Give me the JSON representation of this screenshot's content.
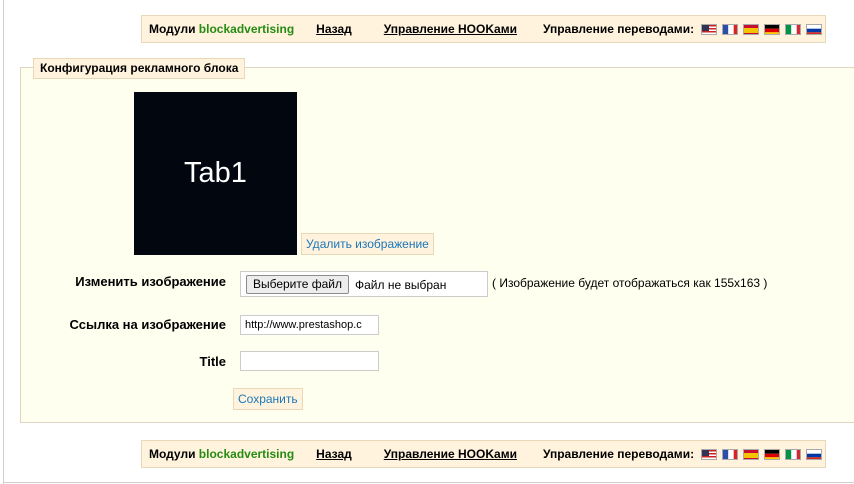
{
  "nav": {
    "modules_prefix": "Модули",
    "module_name": "blockadvertising",
    "back_label": "Назад",
    "hooks_label": "Управление HOOKами",
    "translations_label": "Управление переводами:"
  },
  "form": {
    "legend": "Конфигурация рекламного блока",
    "image_text": "Tab1",
    "delete_image_label": "Удалить изображение",
    "change_image_label": "Изменить изображение",
    "choose_file_label": "Выберите файл",
    "file_status": "Файл не выбран",
    "image_hint": "( Изображение будет отображаться как 155x163 )",
    "image_link_label": "Ссылка на изображение",
    "image_link_value": "http://www.prestashop.c",
    "title_label": "Title",
    "title_value": "",
    "save_label": "Сохранить"
  },
  "colors": {
    "header_bg": "#FFF3DE",
    "panel_bg": "#FFFFF0",
    "module_green": "#268C12",
    "link_blue": "#1A77B8"
  }
}
